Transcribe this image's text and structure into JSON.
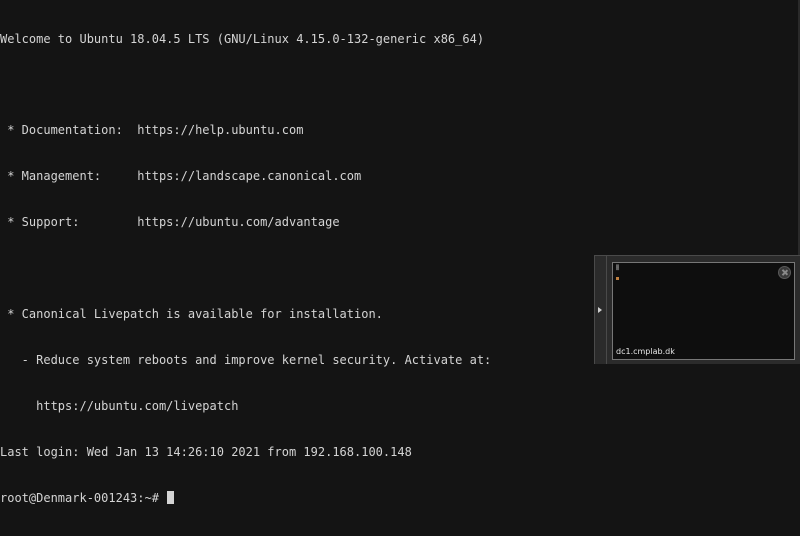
{
  "terminal": {
    "lines": [
      "Welcome to Ubuntu 18.04.5 LTS (GNU/Linux 4.15.0-132-generic x86_64)",
      "",
      " * Documentation:  https://help.ubuntu.com",
      " * Management:     https://landscape.canonical.com",
      " * Support:        https://ubuntu.com/advantage",
      "",
      " * Canonical Livepatch is available for installation.",
      "   - Reduce system reboots and improve kernel security. Activate at:",
      "     https://ubuntu.com/livepatch",
      "Last login: Wed Jan 13 14:26:10 2021 from 192.168.100.148"
    ],
    "prompt": "root@Denmark-001243:~# "
  },
  "preview_panel": {
    "host_label": "dc1.cmplab.dk",
    "close_icon": "close-circle-icon",
    "toggle_icon": "chevron-right-icon"
  },
  "colors": {
    "background": "#141414",
    "text": "#d4d4d4",
    "panel": "#2b2b2b"
  }
}
